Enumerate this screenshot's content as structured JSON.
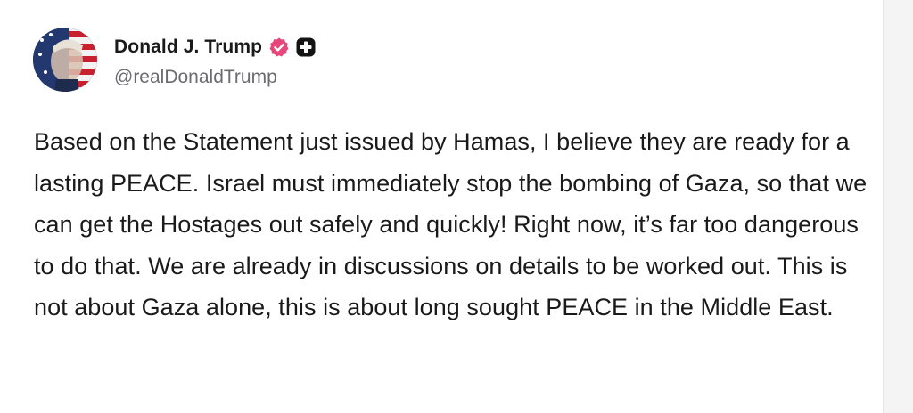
{
  "post": {
    "author": {
      "display_name": "Donald J. Trump",
      "handle": "@realDonaldTrump",
      "verified_badge_icon": "verified-badge-icon",
      "badge_color": "#e5477a",
      "plus_badge_icon": "plus-badge-icon"
    },
    "text": "Based on the Statement just issued by Hamas, I believe they are ready for a lasting PEACE. Israel must immediately stop the bombing of Gaza, so that we can get the Hostages out safely and quickly! Right now, it’s far too dangerous to do that. We are already in discussions on details to be worked out. This is not about Gaza alone, this is about long sought PEACE in the Middle East."
  }
}
